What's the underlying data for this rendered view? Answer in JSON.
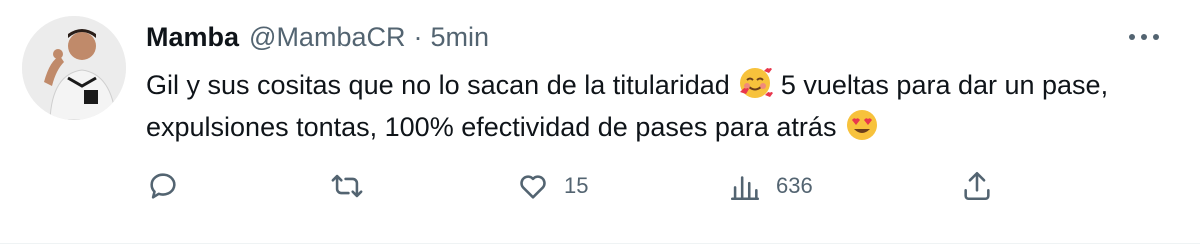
{
  "tweet": {
    "author": {
      "display_name": "Mamba",
      "handle": "@MambaCR",
      "separator": "·",
      "time": "5min",
      "avatar_icon": "player-avatar"
    },
    "text_parts": {
      "part1": "Gil y sus cositas que no lo sacan de la titularidad",
      "emoji1": "smiling-face-with-hearts-emoji",
      "part2": "5 vueltas para dar un pase, expulsiones tontas, 100% efectividad de pases para atrás",
      "emoji2": "heart-eyes-emoji"
    },
    "more_icon": "more-icon",
    "actions": {
      "reply": {
        "icon": "reply-icon",
        "count": ""
      },
      "retweet": {
        "icon": "retweet-icon",
        "count": ""
      },
      "like": {
        "icon": "heart-icon",
        "count": "15"
      },
      "views": {
        "icon": "views-icon",
        "count": "636"
      },
      "share": {
        "icon": "share-icon",
        "count": ""
      }
    },
    "colors": {
      "text": "#0f1419",
      "secondary": "#536471",
      "emoji_yellow": "#f7c23c",
      "heart_red": "#e8374d"
    }
  }
}
